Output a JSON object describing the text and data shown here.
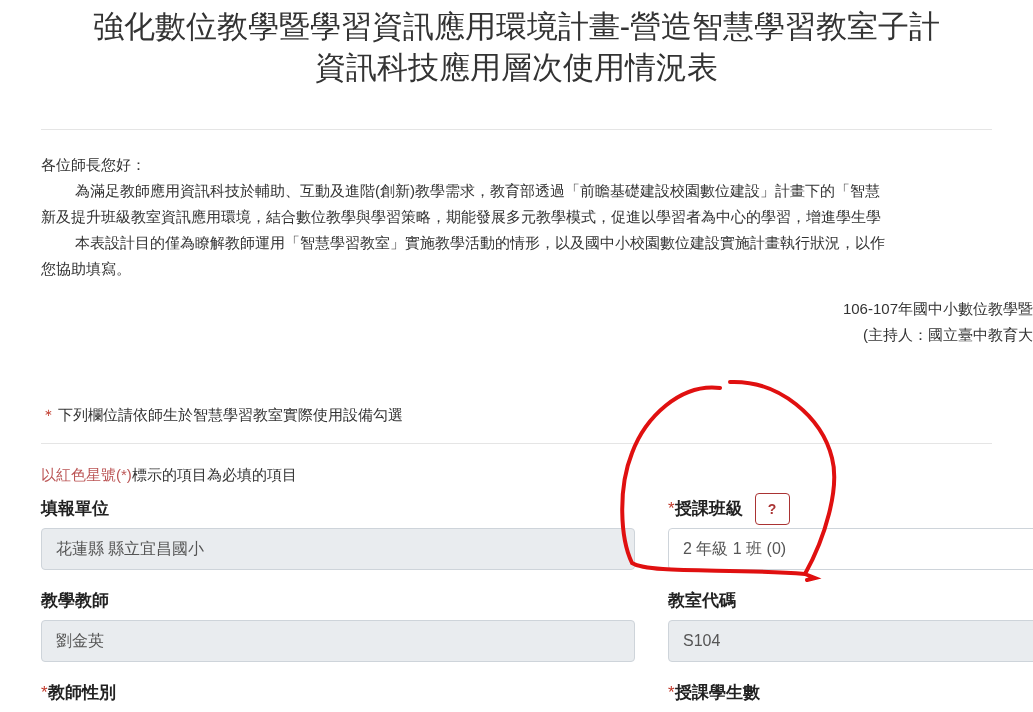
{
  "title_lines": [
    "強化數位教學暨學習資訊應用環境計畫-營造智慧學習教室子計",
    "資訊科技應用層次使用情況表"
  ],
  "intro": {
    "greeting": "各位師長您好：",
    "lines": [
      {
        "text": "為滿足教師應用資訊科技於輔助、互動及進階(創新)教學需求，教育部透過「前瞻基礎建設校園數位建設」計畫下的「智慧",
        "indent": true
      },
      {
        "text": "新及提升班級教室資訊應用環境，結合數位教學與學習策略，期能發展多元教學模式，促進以學習者為中心的學習，增進學生學",
        "indent": false
      },
      {
        "text": "本表設計目的僅為瞭解教師運用「智慧學習教室」實施教學活動的情形，以及國中小校園數位建設實施計畫執行狀況，以作",
        "indent": true
      },
      {
        "text": "您協助填寫。",
        "indent": false
      }
    ]
  },
  "signature": [
    "106-107年國中小數位教學暨",
    "(主持人：國立臺中教育大"
  ],
  "notice": {
    "mark": "＊",
    "text": "下列欄位請依師生於智慧學習教室實際使用設備勾選"
  },
  "required_note": {
    "red_part": "以紅色星號(*)",
    "rest": "標示的項目為必填的項目"
  },
  "fields": [
    {
      "label": "填報單位",
      "value": "花蓮縣 縣立宜昌國小",
      "readonly": true
    },
    {
      "label": "授課班級",
      "required_mark": "*",
      "value": "2 年級 1 班 (0)",
      "readonly": false,
      "help": "?"
    },
    {
      "label": "教學教師",
      "value": "劉金英",
      "readonly": true
    },
    {
      "label": "教室代碼",
      "value": "S104",
      "readonly": true
    },
    {
      "label": "教師性別",
      "required_mark": "*"
    },
    {
      "label": "授課學生數",
      "required_mark": "*"
    }
  ]
}
